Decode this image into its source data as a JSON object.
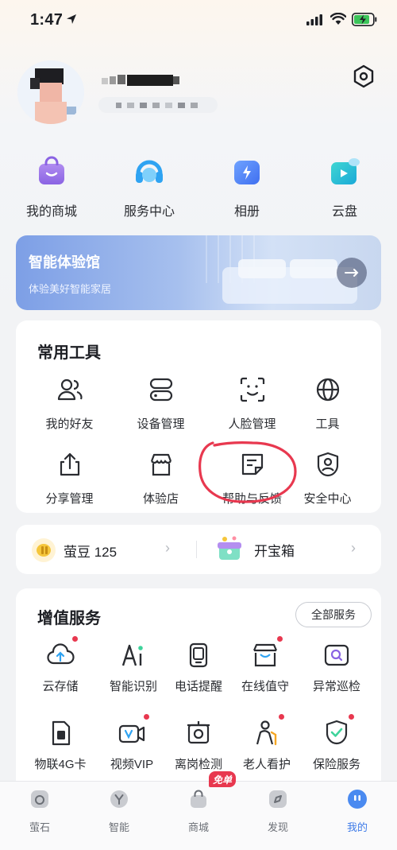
{
  "status_bar": {
    "time": "1:47"
  },
  "quick_actions": [
    {
      "label": "我的商城",
      "icon": "shop-bag-icon"
    },
    {
      "label": "服务中心",
      "icon": "headset-icon"
    },
    {
      "label": "相册",
      "icon": "album-icon"
    },
    {
      "label": "云盘",
      "icon": "cloud-drive-icon"
    }
  ],
  "banner": {
    "title": "智能体验馆",
    "subtitle": "体验美好智能家居"
  },
  "tools": {
    "title": "常用工具",
    "items": [
      {
        "label": "我的好友",
        "icon": "friends-icon"
      },
      {
        "label": "设备管理",
        "icon": "device-manage-icon"
      },
      {
        "label": "人脸管理",
        "icon": "face-scan-icon"
      },
      {
        "label": "工具",
        "icon": "globe-icon"
      },
      {
        "label": "分享管理",
        "icon": "share-icon"
      },
      {
        "label": "体验店",
        "icon": "store-icon"
      },
      {
        "label": "帮助与反馈",
        "icon": "feedback-icon"
      },
      {
        "label": "安全中心",
        "icon": "security-user-icon"
      }
    ]
  },
  "beans": {
    "label": "萤豆 125",
    "treasure_label": "开宝箱"
  },
  "value_services": {
    "title": "增值服务",
    "all_label": "全部服务",
    "items": [
      {
        "label": "云存储",
        "icon": "cloud-upload-icon",
        "dot": true
      },
      {
        "label": "智能识别",
        "icon": "ai-icon",
        "dot": false
      },
      {
        "label": "电话提醒",
        "icon": "phone-alert-icon",
        "dot": false
      },
      {
        "label": "在线值守",
        "icon": "online-guard-icon",
        "dot": true
      },
      {
        "label": "异常巡检",
        "icon": "inspect-icon",
        "dot": false
      },
      {
        "label": "物联4G卡",
        "icon": "sim-card-icon",
        "dot": false
      },
      {
        "label": "视频VIP",
        "icon": "video-vip-icon",
        "dot": true
      },
      {
        "label": "离岗检测",
        "icon": "absence-detect-icon",
        "dot": false
      },
      {
        "label": "老人看护",
        "icon": "elderly-care-icon",
        "dot": true
      },
      {
        "label": "保险服务",
        "icon": "insurance-shield-icon",
        "dot": true
      }
    ]
  },
  "tabbar": {
    "items": [
      {
        "label": "萤石",
        "icon": "home-icon"
      },
      {
        "label": "智能",
        "icon": "smart-icon"
      },
      {
        "label": "商城",
        "icon": "mall-bag-icon"
      },
      {
        "label": "发现",
        "icon": "discover-icon"
      },
      {
        "label": "我的",
        "icon": "profile-icon"
      }
    ],
    "active": "我的",
    "mall_badge": "免单"
  },
  "colors": {
    "accent": "#3f7be8",
    "alert_dot": "#e8384f",
    "annotation_circle": "#e8384f"
  }
}
